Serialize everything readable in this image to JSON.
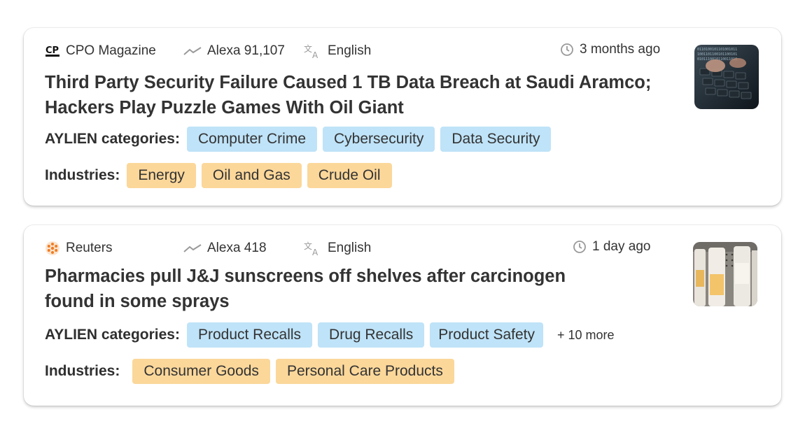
{
  "articles": [
    {
      "source": "CPO Magazine",
      "source_icon": "cpo-magazine-logo",
      "alexa": "Alexa 91,107",
      "language": "English",
      "time": "3 months ago",
      "title_line1": "Third Party Security Failure Caused 1 TB Data Breach at Saudi Aramco;",
      "title_line2": "Hackers Play Puzzle Games With Oil Giant",
      "categories_label": "AYLIEN categories:",
      "categories": [
        "Computer Crime",
        "Cybersecurity",
        "Data Security"
      ],
      "industries_label": "Industries:",
      "industries": [
        "Energy",
        "Oil and Gas",
        "Crude Oil"
      ],
      "thumbnail": "keyboard-image"
    },
    {
      "source": "Reuters",
      "source_icon": "reuters-logo",
      "alexa": "Alexa 418",
      "language": "English",
      "time": "1 day ago",
      "title_line1": "Pharmacies pull J&J sunscreens off shelves after carcinogen",
      "title_line2": "found in some sprays",
      "categories_label": "AYLIEN categories:",
      "categories": [
        "Product Recalls",
        "Drug Recalls",
        "Product Safety"
      ],
      "categories_more": "+ 10 more",
      "industries_label": "Industries:",
      "industries": [
        "Consumer Goods",
        "Personal Care Products"
      ],
      "thumbnail": "sunscreen-bottles-image"
    }
  ],
  "colors": {
    "category_tag": "#bfe3f8",
    "industry_tag": "#fbd79a",
    "text": "#333333",
    "icon_gray": "#9a9a9a"
  }
}
